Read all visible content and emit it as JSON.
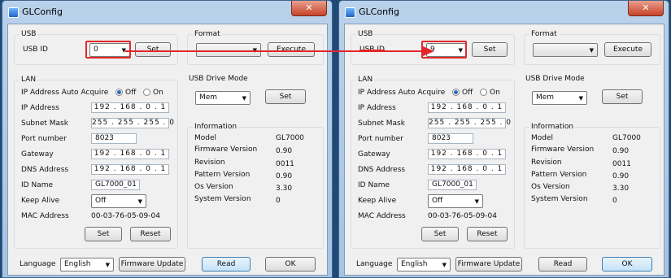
{
  "windows": [
    {
      "title": "GLConfig",
      "close_glyph": "✕",
      "usb": {
        "group": "USB",
        "id_label": "USB ID",
        "id_value": "0",
        "set": "Set"
      },
      "format": {
        "group": "Format",
        "value": "",
        "execute": "Execute"
      },
      "lan": {
        "group": "LAN",
        "auto_acquire_label": "IP Address Auto Acquire",
        "off": "Off",
        "on": "On",
        "ip_label": "IP Address",
        "ip": "192 . 168 .  0  .  1",
        "subnet_label": "Subnet Mask",
        "subnet": "255 . 255 . 255 .  0",
        "port_label": "Port number",
        "port": "8023",
        "gateway_label": "Gateway",
        "gateway": "192 . 168 .  0  .  1",
        "dns_label": "DNS Address",
        "dns": "192 . 168 .  0  .  1",
        "idname_label": "ID Name",
        "idname": "GL7000_01",
        "keepalive_label": "Keep Alive",
        "keepalive": "Off",
        "mac_label": "MAC Address",
        "mac": "00-03-76-05-09-04",
        "set": "Set",
        "reset": "Reset"
      },
      "drive": {
        "group": "USB Drive Mode",
        "value": "Mem",
        "set": "Set"
      },
      "info": {
        "group": "Information",
        "rows": [
          {
            "k": "Model",
            "v": "GL7000"
          },
          {
            "k": "Firmware Version",
            "v": "0.90"
          },
          {
            "k": "Revision",
            "v": "0011"
          },
          {
            "k": "Pattern Version",
            "v": "0.90"
          },
          {
            "k": "Os Version",
            "v": "3.30"
          },
          {
            "k": "System Version",
            "v": "0"
          }
        ]
      },
      "bottom": {
        "language_label": "Language",
        "language": "English",
        "fw_update": "Firmware Update",
        "read": "Read",
        "ok": "OK"
      }
    },
    {
      "title": "GLConfig",
      "close_glyph": "✕",
      "usb": {
        "group": "USB",
        "id_label": "USB ID",
        "id_value": "9",
        "set": "Set"
      },
      "format": {
        "group": "Format",
        "value": "",
        "execute": "Execute"
      },
      "lan": {
        "group": "LAN",
        "auto_acquire_label": "IP Address Auto Acquire",
        "off": "Off",
        "on": "On",
        "ip_label": "IP Address",
        "ip": "192 . 168 .  0  .  1",
        "subnet_label": "Subnet Mask",
        "subnet": "255 . 255 . 255 .  0",
        "port_label": "Port number",
        "port": "8023",
        "gateway_label": "Gateway",
        "gateway": "192 . 168 .  0  .  1",
        "dns_label": "DNS Address",
        "dns": "192 . 168 .  0  .  1",
        "idname_label": "ID Name",
        "idname": "GL7000_01",
        "keepalive_label": "Keep Alive",
        "keepalive": "Off",
        "mac_label": "MAC Address",
        "mac": "00-03-76-05-09-04",
        "set": "Set",
        "reset": "Reset"
      },
      "drive": {
        "group": "USB Drive Mode",
        "value": "Mem",
        "set": "Set"
      },
      "info": {
        "group": "Information",
        "rows": [
          {
            "k": "Model",
            "v": "GL7000"
          },
          {
            "k": "Firmware Version",
            "v": "0.90"
          },
          {
            "k": "Revision",
            "v": "0011"
          },
          {
            "k": "Pattern Version",
            "v": "0.90"
          },
          {
            "k": "Os Version",
            "v": "3.30"
          },
          {
            "k": "System Version",
            "v": "0"
          }
        ]
      },
      "bottom": {
        "language_label": "Language",
        "language": "English",
        "fw_update": "Firmware Update",
        "read": "Read",
        "ok": "OK"
      }
    }
  ],
  "annotation_color": "#e3262a"
}
